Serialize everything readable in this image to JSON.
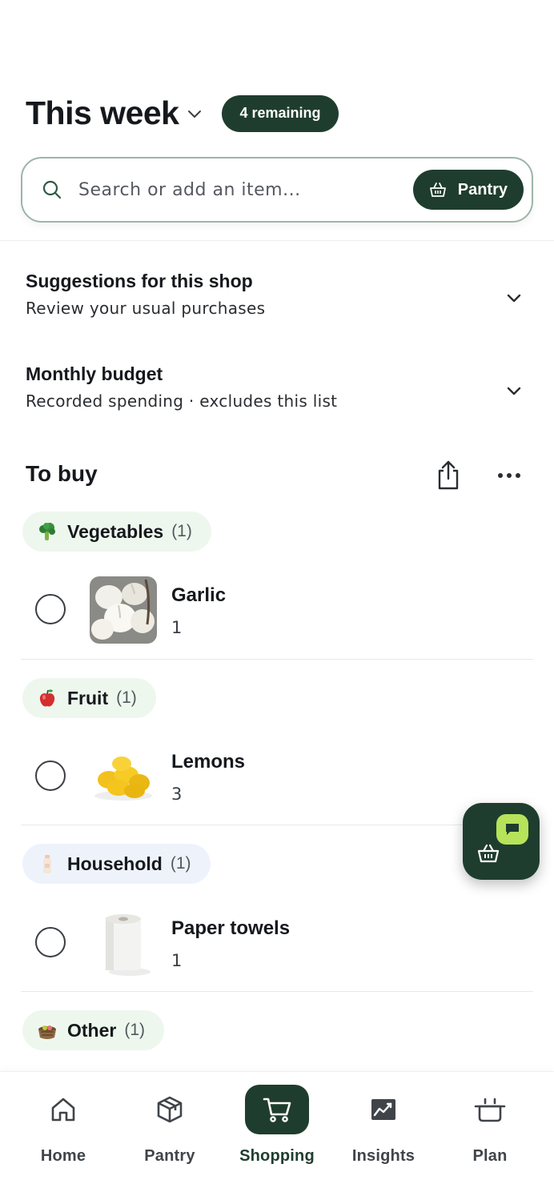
{
  "header": {
    "title": "This week",
    "remaining_badge": "4 remaining"
  },
  "search": {
    "placeholder": "Search or add an item...",
    "value": "",
    "pantry_button": "Pantry"
  },
  "accordions": [
    {
      "title": "Suggestions for this shop",
      "subtitle": "Review your usual purchases"
    },
    {
      "title": "Monthly budget",
      "subtitle": "Recorded spending · excludes this list"
    }
  ],
  "to_buy": {
    "title": "To buy"
  },
  "categories": [
    {
      "name": "Vegetables",
      "count": "(1)",
      "icon": "broccoli-icon",
      "items": [
        {
          "name": "Garlic",
          "qty": "1",
          "image": "garlic-image"
        }
      ]
    },
    {
      "name": "Fruit",
      "count": "(1)",
      "icon": "apple-icon",
      "items": [
        {
          "name": "Lemons",
          "qty": "3",
          "image": "lemons-image"
        }
      ]
    },
    {
      "name": "Household",
      "count": "(1)",
      "icon": "bottle-icon",
      "items": [
        {
          "name": "Paper towels",
          "qty": "1",
          "image": "paper-towels-image"
        }
      ]
    },
    {
      "name": "Other",
      "count": "(1)",
      "icon": "basket-icon",
      "items": []
    }
  ],
  "bottom_nav": [
    {
      "label": "Home",
      "icon": "home-icon",
      "active": false
    },
    {
      "label": "Pantry",
      "icon": "box-icon",
      "active": false
    },
    {
      "label": "Shopping",
      "icon": "cart-icon",
      "active": true
    },
    {
      "label": "Insights",
      "icon": "chart-icon",
      "active": false
    },
    {
      "label": "Plan",
      "icon": "pot-icon",
      "active": false
    }
  ],
  "colors": {
    "primary": "#1f3d2e",
    "accent": "#b6e35a",
    "category_bg_green": "#eef7ee",
    "category_bg_blue": "#eef3fb"
  }
}
